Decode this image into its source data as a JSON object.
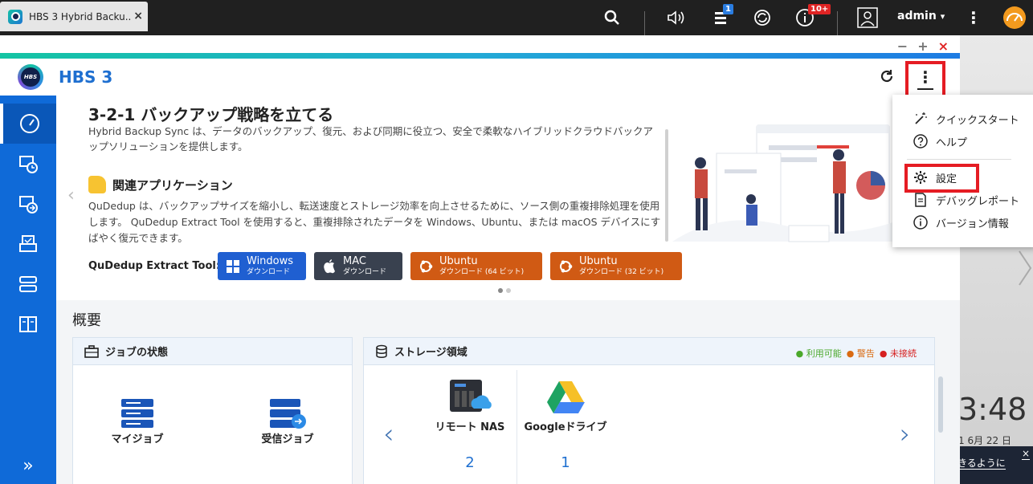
{
  "tab": {
    "title": "HBS 3 Hybrid Backu...",
    "close": "×"
  },
  "system": {
    "notifications_badge": "1",
    "info_badge": "10+",
    "user": "admin",
    "user_caret": "▾"
  },
  "window": {
    "minimize": "−",
    "maximize": "+",
    "close": "×"
  },
  "app": {
    "title": "HBS 3",
    "logo_text": "HBS"
  },
  "banner": {
    "title": "3-2-1 バックアップ戦略を立てる",
    "description": "Hybrid Backup Sync は、データのバックアップ、復元、および同期に役立つ、安全で柔軟なハイブリッドクラウドバックアップソリューションを提供します。",
    "related_title": "関連アプリケーション",
    "related_description": "QuDedup は、バックアップサイズを縮小し、転送速度とストレージ効率を向上させるために、ソース側の重複排除処理を使用します。 QuDedup Extract Tool を使用すると、重複排除されたデータを Windows、Ubuntu、または macOS デバイスにすばやく復元できます。",
    "extract_label": "QuDedup Extract Tool:",
    "downloads": [
      {
        "name": "Windows",
        "sub": "ダウンロード",
        "color": "#1f5fd1"
      },
      {
        "name": "MAC",
        "sub": "ダウンロード",
        "color": "#39414f"
      },
      {
        "name": "Ubuntu",
        "sub": "ダウンロード (64 ビット)",
        "color": "#d05a14"
      },
      {
        "name": "Ubuntu",
        "sub": "ダウンロード (32 ビット)",
        "color": "#d05a14"
      }
    ]
  },
  "overview": {
    "title": "概要",
    "jobs": {
      "title": "ジョブの状態",
      "my_jobs": "マイジョブ",
      "incoming_jobs": "受信ジョブ"
    },
    "storage": {
      "title": "ストレージ領域",
      "legend": [
        {
          "label": "利用可能",
          "color": "#4aa82a"
        },
        {
          "label": "警告",
          "color": "#d96a12"
        },
        {
          "label": "未接続",
          "color": "#d62020"
        }
      ],
      "items": [
        {
          "label": "リモート NAS",
          "count": "2"
        },
        {
          "label": "Googleドライブ",
          "count": "1"
        }
      ]
    }
  },
  "menu": {
    "items": [
      "クイックスタート",
      "ヘルプ",
      "設定",
      "デバッグレポート",
      "バージョン情報"
    ]
  },
  "desktop": {
    "clock": "3:48",
    "date": "1 6月 22 日",
    "notice": "きるように",
    "notice_close": "×"
  }
}
